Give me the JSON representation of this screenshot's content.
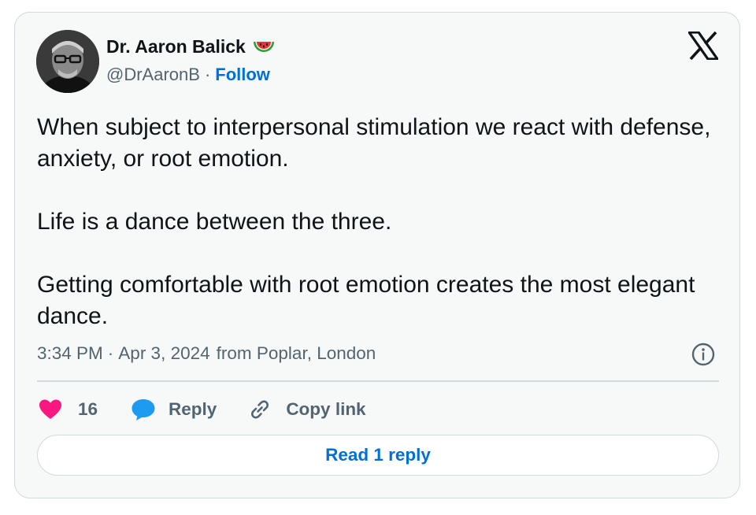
{
  "author": {
    "name": "Dr. Aaron Balick",
    "name_emoji_icon": "watermelon-icon",
    "handle": "@DrAaronB",
    "separator": "·",
    "follow_label": "Follow",
    "avatar_icon": "profile-photo"
  },
  "brand_icon": "x-logo-icon",
  "tweet": {
    "paragraphs": [
      "When subject to interpersonal stimulation we react with defense, anxiety, or root emotion.",
      "Life is a dance between the three.",
      "Getting comfortable with root emotion creates the most elegant dance."
    ]
  },
  "meta": {
    "time": "3:34 PM",
    "separator": "·",
    "date": "Apr 3, 2024",
    "location": "from Poplar, London",
    "info_icon": "info-icon"
  },
  "actions": {
    "like_count": "16",
    "like_icon": "heart-icon",
    "reply_label": "Reply",
    "reply_icon": "speech-bubble-icon",
    "copy_label": "Copy link",
    "copy_icon": "link-icon"
  },
  "read_reply_label": "Read 1 reply",
  "colors": {
    "card_bg": "#f7f9f9",
    "border": "#cfd9de",
    "link_blue": "#006fd6",
    "heart": "#f91880",
    "reply_blue": "#1d9bf0",
    "muted": "#536471",
    "text": "#0f1419"
  }
}
